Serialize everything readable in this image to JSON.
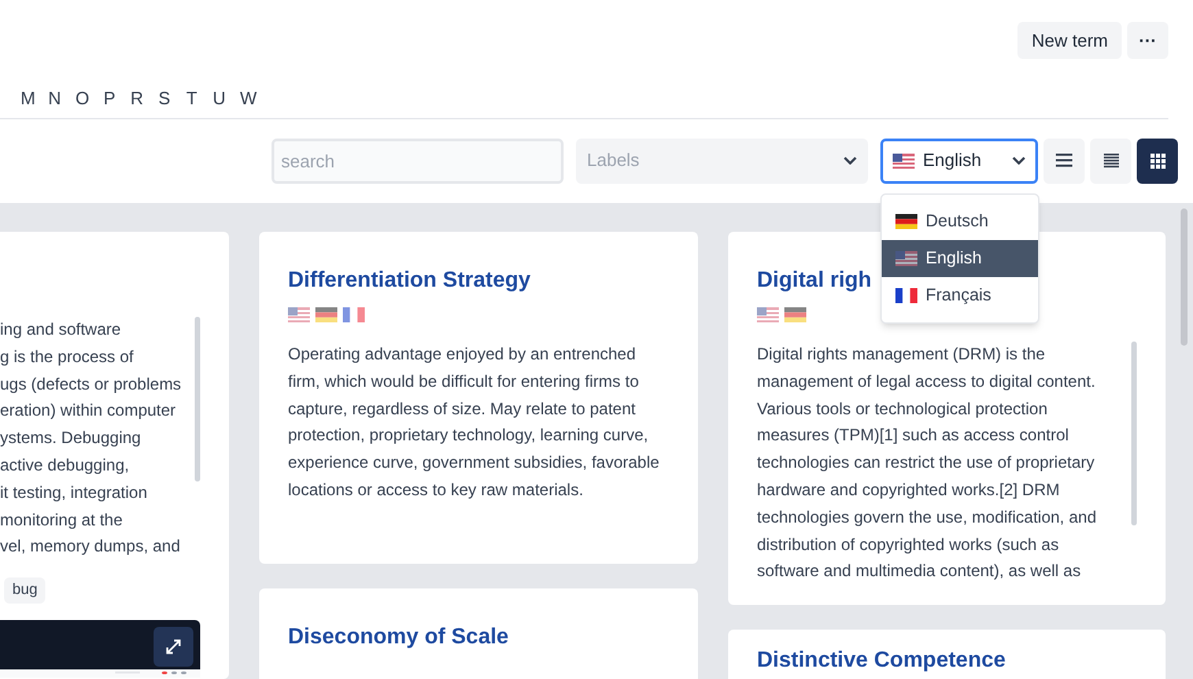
{
  "header": {
    "buttons": [
      {
        "label": "New term",
        "kind": "text"
      },
      {
        "label": "···",
        "kind": "more"
      }
    ]
  },
  "letters": [
    "M",
    "N",
    "O",
    "P",
    "R",
    "S",
    "T",
    "U",
    "W"
  ],
  "toolbar": {
    "search": {
      "placeholder": "search"
    },
    "labels": {
      "placeholder": "Labels"
    },
    "language": {
      "label": "English",
      "flag": {
        "kind": "us"
      },
      "expanded": true
    },
    "view_modes": [
      {
        "kind": "list",
        "selected": false
      },
      {
        "kind": "compact",
        "selected": false
      },
      {
        "kind": "grid",
        "selected": true
      }
    ]
  },
  "language_menu": [
    {
      "label": "Deutsch",
      "flag": {
        "kind": "de"
      },
      "selected": false
    },
    {
      "label": "English",
      "flag": {
        "kind": "us"
      },
      "selected": true
    },
    {
      "label": "Français",
      "flag": {
        "kind": "fr"
      },
      "selected": false
    }
  ],
  "columns": [
    {
      "cards": [
        {
          "lines": [
            "ing and software",
            "g is the process of",
            "ugs (defects or problems",
            "eration) within computer",
            "ystems. Debugging",
            "active debugging,",
            "it testing, integration",
            "monitoring at the",
            "vel, memory dumps, and"
          ],
          "tags": [
            "bug"
          ],
          "preview": {
            "kind": "picture"
          }
        }
      ]
    },
    {
      "cards": [
        {
          "title": "Differentiation Strategy",
          "flags": [
            {
              "kind": "us"
            },
            {
              "kind": "de"
            },
            {
              "kind": "fr"
            }
          ],
          "text": "Operating advantage enjoyed by an entrenched firm, which would be difficult for entering firms to capture, regardless of size. May relate to patent protection, proprietary technology, learning curve, experience curve, government subsidies, favorable locations or access to key raw materials."
        },
        {
          "title": "Diseconomy of Scale"
        }
      ]
    },
    {
      "cards": [
        {
          "title": "Digital righ",
          "flags": [
            {
              "kind": "us"
            },
            {
              "kind": "de"
            }
          ],
          "text": "Digital rights management (DRM) is the management of legal access to digital content. Various tools or technological protection measures (TPM)[1] such as access control technologies can restrict the use of proprietary hardware and copyrighted works.[2] DRM technologies govern the use, modification, and distribution of copyrighted works (such as software and multimedia content), as well as"
        },
        {
          "title": "Distinctive Competence"
        }
      ]
    }
  ]
}
